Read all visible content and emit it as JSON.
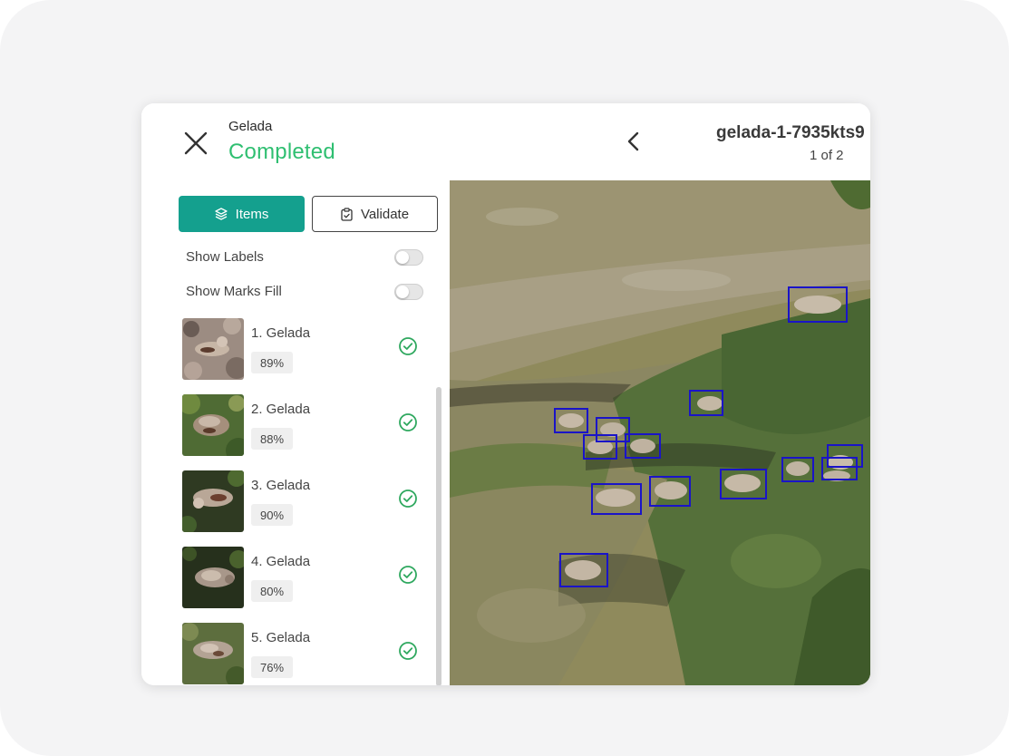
{
  "header": {
    "project_name": "Gelada",
    "status": "Completed",
    "item_title": "gelada-1-7935kts9",
    "counter": "1 of 2"
  },
  "toolbar": {
    "items_label": "Items",
    "validate_label": "Validate"
  },
  "toggles": {
    "show_labels": "Show Labels",
    "show_marks_fill": "Show Marks Fill",
    "show_labels_on": false,
    "show_marks_fill_on": false
  },
  "items": [
    {
      "label": "1. Gelada",
      "confidence": "89%",
      "validated": true
    },
    {
      "label": "2. Gelada",
      "confidence": "88%",
      "validated": true
    },
    {
      "label": "3. Gelada",
      "confidence": "90%",
      "validated": true
    },
    {
      "label": "4. Gelada",
      "confidence": "80%",
      "validated": true
    },
    {
      "label": "5. Gelada",
      "confidence": "76%",
      "validated": true
    }
  ],
  "colors": {
    "accent": "#14a08e",
    "status": "#2fbf71",
    "check": "#2fa85f",
    "bbox": "#1a14c8"
  },
  "icons": {
    "close": "close-icon",
    "back": "chevron-left-icon",
    "items": "layers-icon",
    "validate": "clipboard-check-icon",
    "validated": "check-circle-icon"
  }
}
